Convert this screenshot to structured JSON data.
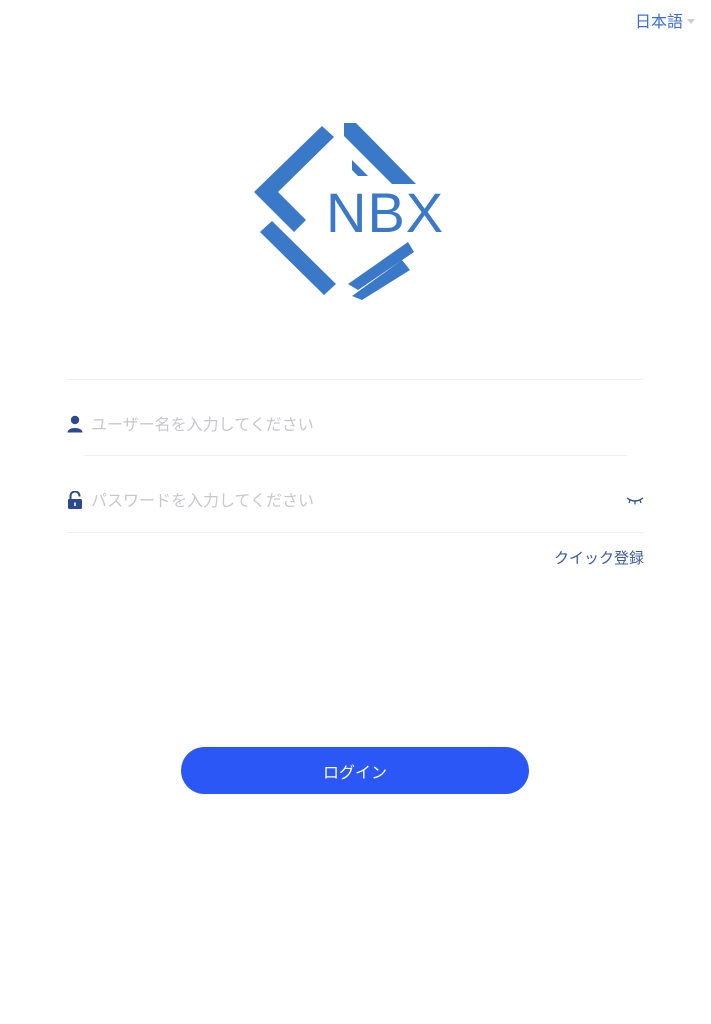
{
  "header": {
    "language_label": "日本語"
  },
  "logo": {
    "text": "NBX",
    "color": "#3a78c8"
  },
  "form": {
    "username_placeholder": "ユーザー名を入力してください",
    "password_placeholder": "パスワードを入力してください",
    "username_icon": "user-icon",
    "password_icon": "lock-icon",
    "visibility_icon": "eye-closed-icon",
    "quick_register_label": "クイック登録",
    "login_label": "ログイン"
  },
  "colors": {
    "accent": "#2a57f5",
    "link": "#3b6fd6",
    "icon": "#2a4a8f"
  }
}
